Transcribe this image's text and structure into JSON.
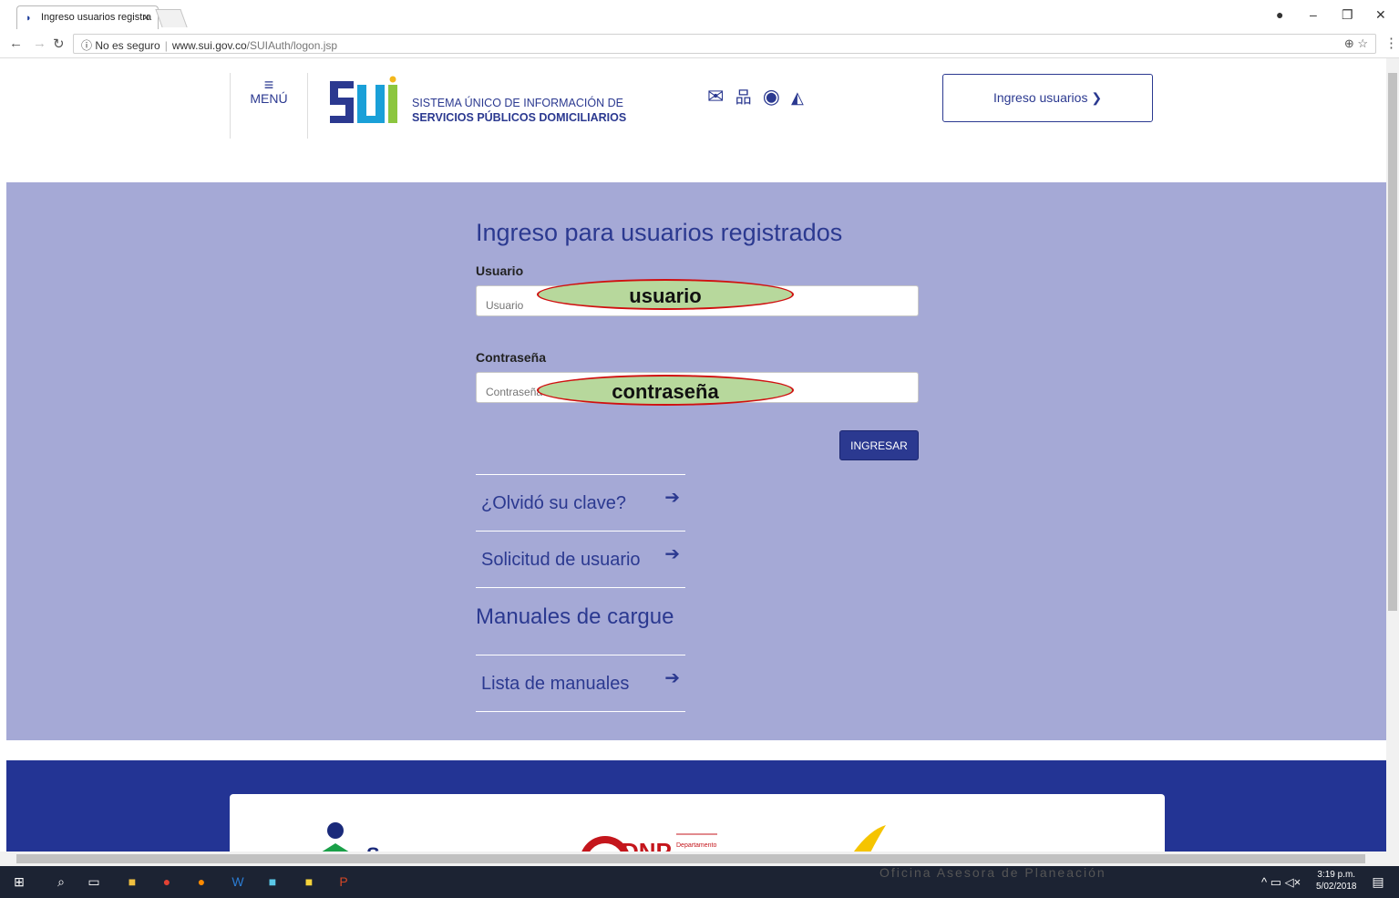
{
  "browser": {
    "tab_title": "Ingreso usuarios registra",
    "tab_close": "×",
    "url_security": "ⓘ No es seguro",
    "url_domain": "www.sui.gov.co",
    "url_path": "/SUIAuth/logon.jsp"
  },
  "header": {
    "menu_icon": "≡",
    "menu_label": "MENÚ",
    "logo_line1": "SISTEMA ÚNICO DE INFORMACIÓN DE",
    "logo_line2": "SERVICIOS PÚBLICOS DOMICILIARIOS",
    "icons": [
      "mail-icon",
      "sitemap-icon",
      "accessibility-icon",
      "graduation-cap-icon"
    ],
    "login_button": "Ingreso usuarios ❯"
  },
  "login": {
    "title": "Ingreso para usuarios registrados",
    "user_label": "Usuario",
    "user_placeholder": "Usuario",
    "user_annotation": "usuario",
    "password_label": "Contraseña",
    "password_placeholder": "Contraseña",
    "password_annotation": "contraseña",
    "submit": "INGRESAR"
  },
  "links": {
    "forgot": "¿Olvidó su clave?",
    "request": "Solicitud de usuario",
    "manuals_heading": "Manuales de cargue",
    "manuals_list": "Lista de manuales",
    "arrow": "➔"
  },
  "footer": {
    "watermark": "Oficina Asesora de Planeación",
    "dnp_small": "Departamento"
  },
  "taskbar": {
    "time": "3:19 p.m.",
    "date": "5/02/2018"
  },
  "colors": {
    "brand_blue": "#2b3990",
    "band": "#a5a9d6",
    "footer_blue": "#233494",
    "annotation_fill": "#b7d89c",
    "annotation_stroke": "#d01010"
  }
}
